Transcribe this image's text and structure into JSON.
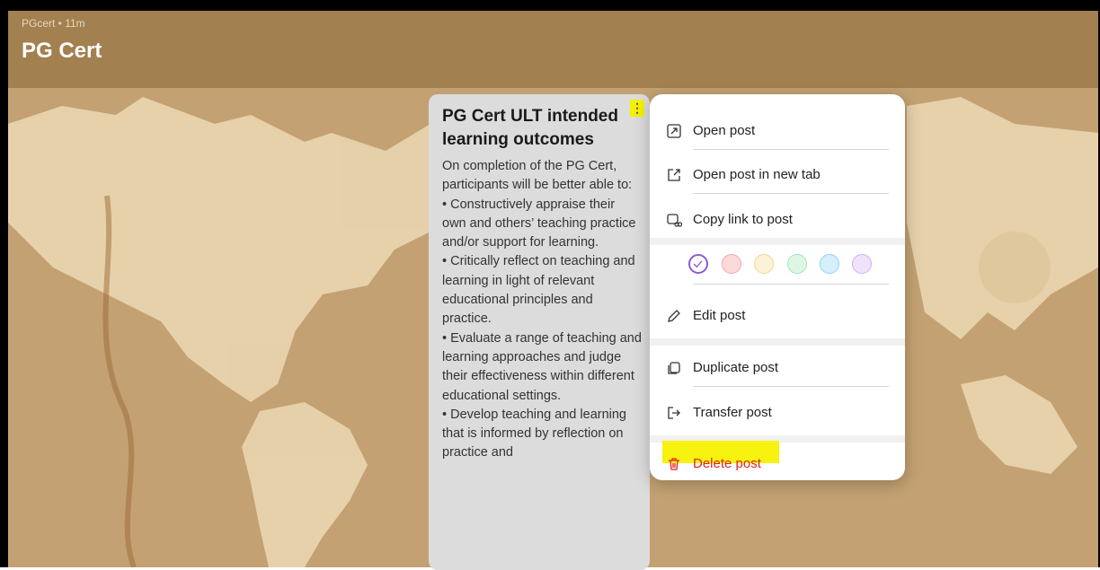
{
  "header": {
    "meta": "PGcert • 11m",
    "title": "PG Cert"
  },
  "post": {
    "title": "PG Cert ULT intended learning outcomes",
    "body": "On completion of the PG Cert, participants will be better able to:\n• Constructively appraise their own and others’ teaching practice and/or support for learning.\n• Critically reflect on teaching and learning in light of relevant educational principles and practice.\n• Evaluate a range of teaching and learning approaches and judge their effectiveness within different educational settings.\n• Develop teaching and learning that is informed by reflection on practice and",
    "menu_icon": "kebab-icon"
  },
  "menu": {
    "items": [
      {
        "label": "Open post",
        "icon": "expand-icon"
      },
      {
        "label": "Open post in new tab",
        "icon": "external-link-icon"
      },
      {
        "label": "Copy link to post",
        "icon": "link-icon"
      },
      {
        "label": "Edit post",
        "icon": "pencil-icon"
      },
      {
        "label": "Duplicate post",
        "icon": "duplicate-icon"
      },
      {
        "label": "Transfer post",
        "icon": "transfer-icon"
      },
      {
        "label": "Delete post",
        "icon": "trash-icon"
      }
    ],
    "colors": [
      {
        "name": "white",
        "fill": "#ffffff",
        "stroke": "#8a5cd8",
        "selected": true
      },
      {
        "name": "red",
        "fill": "#fadada",
        "stroke": "#f3a6a6",
        "selected": false
      },
      {
        "name": "yellow",
        "fill": "#fdf1d6",
        "stroke": "#f1d59a",
        "selected": false
      },
      {
        "name": "green",
        "fill": "#def7e4",
        "stroke": "#a6e3b4",
        "selected": false
      },
      {
        "name": "blue",
        "fill": "#d6effb",
        "stroke": "#8fd2ef",
        "selected": false
      },
      {
        "name": "purple",
        "fill": "#efe3fb",
        "stroke": "#cfb0f0",
        "selected": false
      }
    ]
  },
  "colors": {
    "header": "#a3804f",
    "board": "#c9a87a",
    "danger": "#e2231a",
    "highlight": "#f7f210"
  }
}
